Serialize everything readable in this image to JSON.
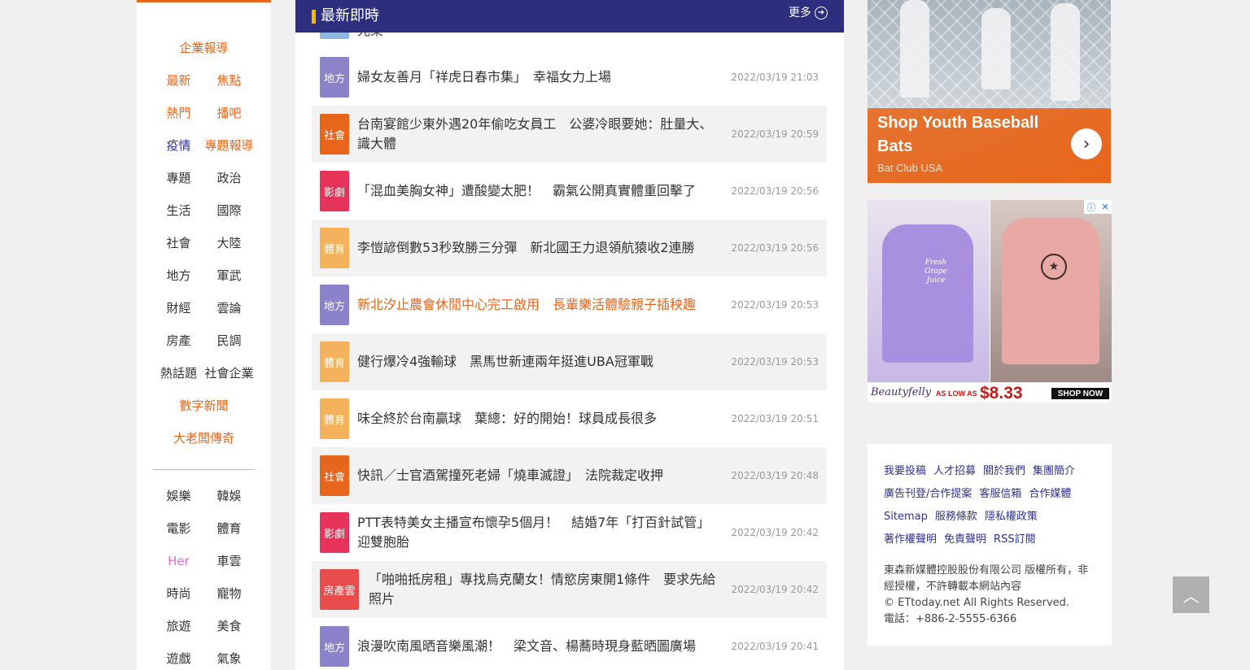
{
  "sidebar": {
    "top": [
      {
        "type": "single",
        "items": [
          {
            "label": "企業報導",
            "color": "orange"
          }
        ]
      },
      {
        "type": "pair",
        "items": [
          {
            "label": "最新",
            "color": "orange"
          },
          {
            "label": "焦點",
            "color": "orange"
          }
        ]
      },
      {
        "type": "pair",
        "items": [
          {
            "label": "熱門",
            "color": "orange"
          },
          {
            "label": "播吧",
            "color": "orange"
          }
        ]
      },
      {
        "type": "pair",
        "items": [
          {
            "label": "疫情",
            "color": "navy"
          },
          {
            "label": "專題報導",
            "color": "orange"
          }
        ]
      },
      {
        "type": "pair",
        "items": [
          {
            "label": "專題",
            "color": ""
          },
          {
            "label": "政治",
            "color": ""
          }
        ]
      },
      {
        "type": "pair",
        "items": [
          {
            "label": "生活",
            "color": ""
          },
          {
            "label": "國際",
            "color": ""
          }
        ]
      },
      {
        "type": "pair",
        "items": [
          {
            "label": "社會",
            "color": ""
          },
          {
            "label": "大陸",
            "color": ""
          }
        ]
      },
      {
        "type": "pair",
        "items": [
          {
            "label": "地方",
            "color": ""
          },
          {
            "label": "軍武",
            "color": ""
          }
        ]
      },
      {
        "type": "pair",
        "items": [
          {
            "label": "財經",
            "color": ""
          },
          {
            "label": "雲論",
            "color": ""
          }
        ]
      },
      {
        "type": "pair",
        "items": [
          {
            "label": "房產",
            "color": ""
          },
          {
            "label": "民調",
            "color": ""
          }
        ]
      },
      {
        "type": "pair",
        "items": [
          {
            "label": "熱話題",
            "color": ""
          },
          {
            "label": "社會企業",
            "color": ""
          }
        ]
      },
      {
        "type": "single",
        "items": [
          {
            "label": "數字新聞",
            "color": "orange"
          }
        ]
      },
      {
        "type": "single",
        "items": [
          {
            "label": "大老闆傳奇",
            "color": "orange"
          }
        ]
      }
    ],
    "bottom": [
      {
        "type": "pair",
        "items": [
          {
            "label": "娛樂",
            "color": ""
          },
          {
            "label": "韓娛",
            "color": ""
          }
        ]
      },
      {
        "type": "pair",
        "items": [
          {
            "label": "電影",
            "color": ""
          },
          {
            "label": "體育",
            "color": ""
          }
        ]
      },
      {
        "type": "pair",
        "items": [
          {
            "label": "Her",
            "color": "pink"
          },
          {
            "label": "車雲",
            "color": ""
          }
        ]
      },
      {
        "type": "pair",
        "items": [
          {
            "label": "時尚",
            "color": ""
          },
          {
            "label": "寵物",
            "color": ""
          }
        ]
      },
      {
        "type": "pair",
        "items": [
          {
            "label": "旅遊",
            "color": ""
          },
          {
            "label": "美食",
            "color": ""
          }
        ]
      },
      {
        "type": "pair",
        "items": [
          {
            "label": "遊戲",
            "color": ""
          },
          {
            "label": "氣象",
            "color": ""
          }
        ]
      }
    ]
  },
  "news": {
    "title": "最新即時",
    "more_label": "更多",
    "partial_headline": "光榮",
    "items": [
      {
        "category": "地方",
        "badge": "local",
        "headline": "婦女友善月「祥虎日春市集」　幸福女力上場",
        "time": "2022/03/19 21:03",
        "highlight": false
      },
      {
        "category": "社會",
        "badge": "social",
        "headline": "台南宴館少東外遇20年偷吃女員工　公婆冷眼要她：肚量大、識大體",
        "time": "2022/03/19 20:59",
        "highlight": false
      },
      {
        "category": "影劇",
        "badge": "film",
        "headline": "「混血美胸女神」遭酸變太肥！　霸氣公開真實體重回擊了",
        "time": "2022/03/19 20:56",
        "highlight": false
      },
      {
        "category": "體育",
        "badge": "sport",
        "headline": "李愷諺倒數53秒致勝三分彈　新北國王力退領航猿收2連勝",
        "time": "2022/03/19 20:56",
        "highlight": false
      },
      {
        "category": "地方",
        "badge": "local",
        "headline": "新北汐止農會休閒中心完工啟用　長輩樂活體驗親子插秧趣",
        "time": "2022/03/19 20:53",
        "highlight": true
      },
      {
        "category": "體育",
        "badge": "sport",
        "headline": "健行爆冷4強輸球　黑馬世新連兩年挺進UBA冠軍戰",
        "time": "2022/03/19 20:53",
        "highlight": false
      },
      {
        "category": "體育",
        "badge": "sport",
        "headline": "味全終於台南贏球　葉總：好的開始！球員成長很多",
        "time": "2022/03/19 20:51",
        "highlight": false
      },
      {
        "category": "社會",
        "badge": "social",
        "headline": "快訊／士官酒駕撞死老婦「燒車滅證」　法院裁定收押",
        "time": "2022/03/19 20:48",
        "highlight": false
      },
      {
        "category": "影劇",
        "badge": "film",
        "headline": "PTT表特美女主播宣布懷孕5個月！　結婚7年「打百針試管」迎雙胞胎",
        "time": "2022/03/19 20:42",
        "highlight": false
      },
      {
        "category": "房產雲",
        "badge": "house",
        "headline": "「啪啪抵房租」專找烏克蘭女！情慾房東開1條件　要求先給照片",
        "time": "2022/03/19 20:42",
        "highlight": false
      },
      {
        "category": "地方",
        "badge": "local",
        "headline": "浪漫吹南風晒音樂風潮！　梁文音、楊蕎時現身藍晒圖廣場",
        "time": "2022/03/19 20:41",
        "highlight": false
      }
    ]
  },
  "ad1": {
    "title": "Shop Youth Baseball Bats",
    "brand": "Bat Club USA"
  },
  "ad2": {
    "shirt_text": "Fresh Grape Juice",
    "brand": "Beautyfelly",
    "as_low_as": "AS LOW AS",
    "price": "$8.33",
    "cta": "SHOP NOW"
  },
  "footer": {
    "link_lines": [
      [
        "我要投稿",
        "人才招募",
        "關於我們",
        "集團簡介"
      ],
      [
        "廣告刊登/合作提案",
        "客服信箱",
        "合作媒體"
      ],
      [
        "Sitemap",
        "服務條款",
        "隱私權政策"
      ],
      [
        "著作權聲明",
        "免責聲明",
        "RSS訂閱"
      ]
    ],
    "copyright_lines": [
      "東森新媒體控股股份有限公司 版權所有，非經授權，不許轉載本網站內容",
      "© ETtoday.net All Rights Reserved.",
      "電話：+886-2-5555-6366"
    ]
  },
  "colors": {
    "accent": "#e8661b",
    "navy": "#2e2e7e",
    "header_bar": "#f5b800"
  }
}
